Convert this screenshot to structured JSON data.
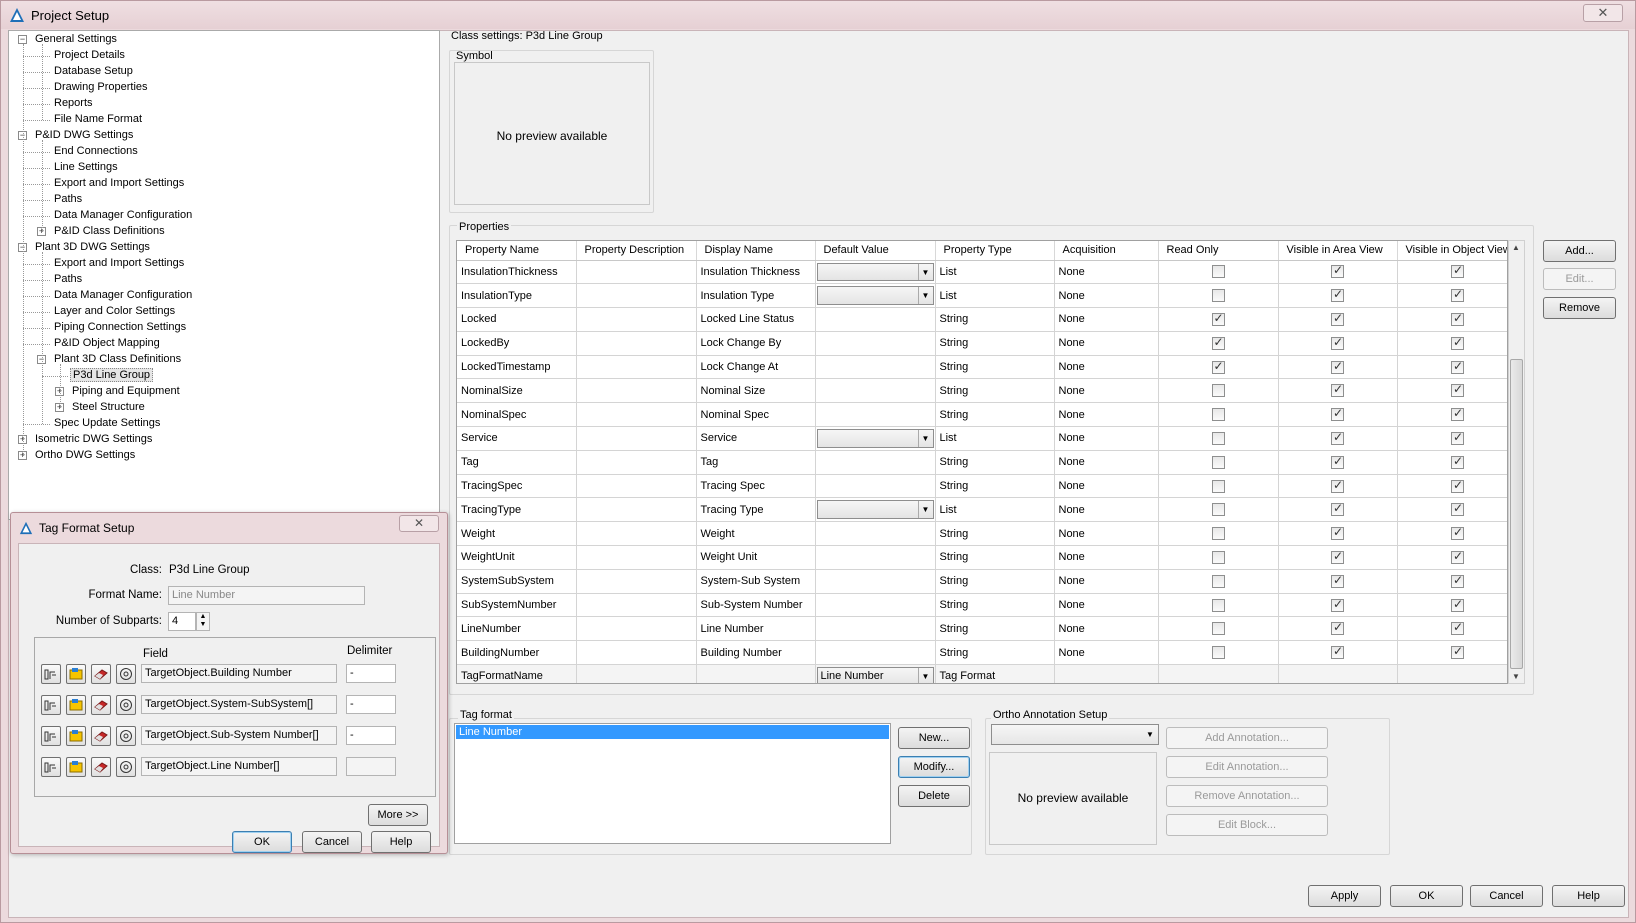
{
  "window": {
    "title": "Project Setup",
    "close": "✕"
  },
  "tree": [
    {
      "label": "General Settings",
      "level": 0,
      "expander": "−"
    },
    {
      "label": "Project Details",
      "level": 1
    },
    {
      "label": "Database Setup",
      "level": 1
    },
    {
      "label": "Drawing Properties",
      "level": 1
    },
    {
      "label": "Reports",
      "level": 1
    },
    {
      "label": "File Name Format",
      "level": 1
    },
    {
      "label": "P&ID DWG Settings",
      "level": 0,
      "expander": "−"
    },
    {
      "label": "End Connections",
      "level": 1
    },
    {
      "label": "Line Settings",
      "level": 1
    },
    {
      "label": "Export and Import Settings",
      "level": 1
    },
    {
      "label": "Paths",
      "level": 1
    },
    {
      "label": "Data Manager Configuration",
      "level": 1
    },
    {
      "label": "P&ID Class Definitions",
      "level": 1,
      "expander": "+"
    },
    {
      "label": "Plant 3D DWG Settings",
      "level": 0,
      "expander": "−"
    },
    {
      "label": "Export and Import Settings",
      "level": 1
    },
    {
      "label": "Paths",
      "level": 1
    },
    {
      "label": "Data Manager Configuration",
      "level": 1
    },
    {
      "label": "Layer and Color Settings",
      "level": 1
    },
    {
      "label": "Piping Connection Settings",
      "level": 1
    },
    {
      "label": "P&ID Object Mapping",
      "level": 1
    },
    {
      "label": "Plant 3D Class Definitions",
      "level": 1,
      "expander": "−"
    },
    {
      "label": "P3d Line Group",
      "level": 2,
      "selected": true
    },
    {
      "label": "Piping and Equipment",
      "level": 2,
      "expander": "+"
    },
    {
      "label": "Steel Structure",
      "level": 2,
      "expander": "+"
    },
    {
      "label": "Spec Update Settings",
      "level": 1
    },
    {
      "label": "Isometric DWG Settings",
      "level": 0,
      "expander": "+"
    },
    {
      "label": "Ortho DWG Settings",
      "level": 0,
      "expander": "+"
    }
  ],
  "class_settings": {
    "title": "Class settings: P3d Line Group",
    "symbol_label": "Symbol",
    "symbol_preview": "No preview available",
    "properties_label": "Properties"
  },
  "grid": {
    "columns": [
      "Property Name",
      "Property Description",
      "Display Name",
      "Default Value",
      "Property Type",
      "Acquisition",
      "Read Only",
      "Visible in Area View",
      "Visible in Object View"
    ],
    "rows": [
      {
        "name": "InsulationThickness",
        "desc": "",
        "display": "Insulation Thickness",
        "default": "",
        "default_dropdown": true,
        "type": "List",
        "acq": "None",
        "ro": false,
        "area": true,
        "obj": true
      },
      {
        "name": "InsulationType",
        "desc": "",
        "display": "Insulation Type",
        "default": "",
        "default_dropdown": true,
        "type": "List",
        "acq": "None",
        "ro": false,
        "area": true,
        "obj": true
      },
      {
        "name": "Locked",
        "desc": "",
        "display": "Locked Line Status",
        "default": "",
        "type": "String",
        "acq": "None",
        "ro": true,
        "area": true,
        "obj": true
      },
      {
        "name": "LockedBy",
        "desc": "",
        "display": "Lock Change By",
        "default": "",
        "type": "String",
        "acq": "None",
        "ro": true,
        "area": true,
        "obj": true
      },
      {
        "name": "LockedTimestamp",
        "desc": "",
        "display": "Lock Change At",
        "default": "",
        "type": "String",
        "acq": "None",
        "ro": true,
        "area": true,
        "obj": true
      },
      {
        "name": "NominalSize",
        "desc": "",
        "display": "Nominal Size",
        "default": "",
        "type": "String",
        "acq": "None",
        "ro": false,
        "area": true,
        "obj": true
      },
      {
        "name": "NominalSpec",
        "desc": "",
        "display": "Nominal Spec",
        "default": "",
        "type": "String",
        "acq": "None",
        "ro": false,
        "area": true,
        "obj": true
      },
      {
        "name": "Service",
        "desc": "",
        "display": "Service",
        "default": "",
        "default_dropdown": true,
        "type": "List",
        "acq": "None",
        "ro": false,
        "area": true,
        "obj": true
      },
      {
        "name": "Tag",
        "desc": "",
        "display": "Tag",
        "default": "",
        "type": "String",
        "acq": "None",
        "ro": false,
        "area": true,
        "obj": true
      },
      {
        "name": "TracingSpec",
        "desc": "",
        "display": "Tracing Spec",
        "default": "",
        "type": "String",
        "acq": "None",
        "ro": false,
        "area": true,
        "obj": true
      },
      {
        "name": "TracingType",
        "desc": "",
        "display": "Tracing Type",
        "default": "",
        "default_dropdown": true,
        "type": "List",
        "acq": "None",
        "ro": false,
        "area": true,
        "obj": true
      },
      {
        "name": "Weight",
        "desc": "",
        "display": "Weight",
        "default": "",
        "type": "String",
        "acq": "None",
        "ro": false,
        "area": true,
        "obj": true
      },
      {
        "name": "WeightUnit",
        "desc": "",
        "display": "Weight Unit",
        "default": "",
        "type": "String",
        "acq": "None",
        "ro": false,
        "area": true,
        "obj": true
      },
      {
        "name": "SystemSubSystem",
        "desc": "",
        "display": "System-Sub System",
        "default": "",
        "type": "String",
        "acq": "None",
        "ro": false,
        "area": true,
        "obj": true
      },
      {
        "name": "SubSystemNumber",
        "desc": "",
        "display": "Sub-System Number",
        "default": "",
        "type": "String",
        "acq": "None",
        "ro": false,
        "area": true,
        "obj": true
      },
      {
        "name": "LineNumber",
        "desc": "",
        "display": "Line Number",
        "default": "",
        "type": "String",
        "acq": "None",
        "ro": false,
        "area": true,
        "obj": true
      },
      {
        "name": "BuildingNumber",
        "desc": "",
        "display": "Building Number",
        "default": "",
        "type": "String",
        "acq": "None",
        "ro": false,
        "area": true,
        "obj": true
      },
      {
        "name": "TagFormatName",
        "desc": "",
        "display": "",
        "default": "Line Number",
        "default_dropdown": true,
        "type": "Tag Format",
        "acq": "",
        "ro": null,
        "area": null,
        "obj": null
      }
    ]
  },
  "side_buttons": {
    "add": "Add...",
    "edit": "Edit...",
    "remove": "Remove"
  },
  "tag_format": {
    "label": "Tag format",
    "items": [
      "Line Number"
    ],
    "new": "New...",
    "modify": "Modify...",
    "delete": "Delete"
  },
  "ortho": {
    "label": "Ortho Annotation Setup",
    "combo_value": "",
    "preview": "No preview available",
    "add": "Add Annotation...",
    "edit": "Edit Annotation...",
    "remove": "Remove Annotation...",
    "edit_block": "Edit Block..."
  },
  "footer": {
    "apply": "Apply",
    "ok": "OK",
    "cancel": "Cancel",
    "help": "Help"
  },
  "tag_dialog": {
    "title": "Tag Format Setup",
    "close": "✕",
    "class_label": "Class:",
    "class_value": "P3d Line Group",
    "format_name_label": "Format Name:",
    "format_name_placeholder": "Line Number",
    "subparts_label": "Number of Subparts:",
    "subparts_value": "4",
    "field_header": "Field",
    "delimiter_header": "Delimiter",
    "subparts": [
      {
        "field": "TargetObject.Building Number",
        "delimiter": "-"
      },
      {
        "field": "TargetObject.System-SubSystem[]",
        "delimiter": "-"
      },
      {
        "field": "TargetObject.Sub-System Number[]",
        "delimiter": "-"
      },
      {
        "field": "TargetObject.Line Number[]",
        "delimiter": ""
      }
    ],
    "more": "More >>",
    "ok": "OK",
    "cancel": "Cancel",
    "help": "Help"
  },
  "colors": {
    "accent": "#3399ff",
    "frame": "#ecdadd"
  }
}
